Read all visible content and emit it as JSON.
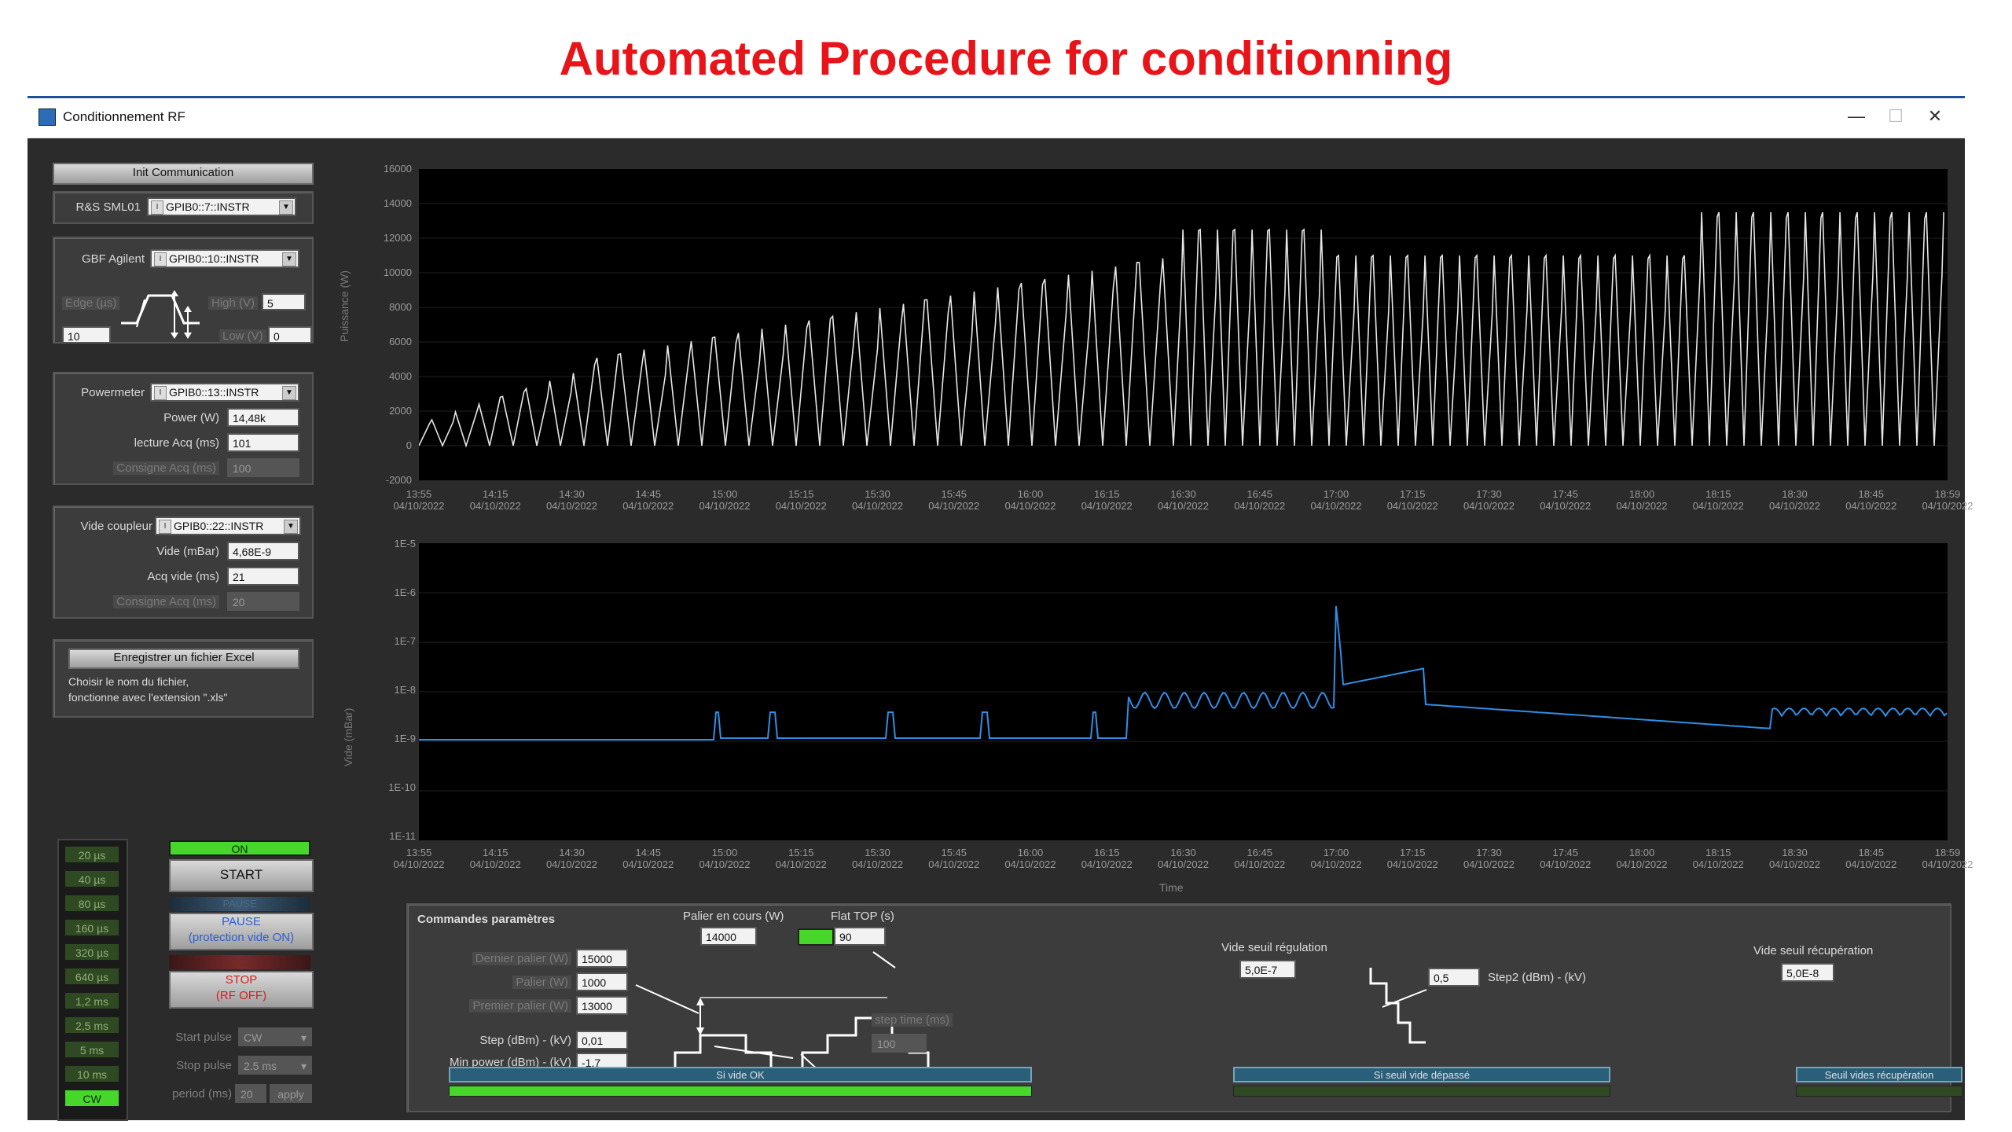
{
  "page_title": "Automated Procedure for conditionning",
  "window": {
    "title": "Conditionnement RF",
    "minimize": "—",
    "maximize": "☐",
    "close": "✕"
  },
  "left": {
    "init_button": "Init Communication",
    "sml": {
      "label": "R&S SML01",
      "value": "GPIB0::7::INSTR"
    },
    "gbf": {
      "label": "GBF Agilent",
      "value": "GPIB0::10::INSTR",
      "edge_label": "Edge (µs)",
      "edge_value": "10",
      "high_label": "High (V)",
      "high_value": "5",
      "low_label": "Low (V)",
      "low_value": "0"
    },
    "powermeter": {
      "label": "Powermeter",
      "value": "GPIB0::13::INSTR",
      "power_label": "Power (W)",
      "power_value": "14,48k",
      "lecture_label": "lecture Acq (ms)",
      "lecture_value": "101",
      "consigne_label": "Consigne Acq (ms)",
      "consigne_value": "100"
    },
    "vide": {
      "label": "Vide coupleur",
      "value": "GPIB0::22::INSTR",
      "vide_label": "Vide (mBar)",
      "vide_value": "4,68E-9",
      "acq_label": "Acq vide (ms)",
      "acq_value": "21",
      "consigne_label": "Consigne Acq (ms)",
      "consigne_value": "20"
    },
    "excel": {
      "button": "Enregistrer un fichier Excel",
      "note1": "Choisir le nom du fichier,",
      "note2": "fonctionne avec l'extension \".xls\""
    }
  },
  "leds": [
    {
      "label": "20 µs",
      "on": false
    },
    {
      "label": "40 µs",
      "on": false
    },
    {
      "label": "80 µs",
      "on": false
    },
    {
      "label": "160 µs",
      "on": false
    },
    {
      "label": "320 µs",
      "on": false
    },
    {
      "label": "640 µs",
      "on": false
    },
    {
      "label": "1,2 ms",
      "on": false
    },
    {
      "label": "2,5 ms",
      "on": false
    },
    {
      "label": "5 ms",
      "on": false
    },
    {
      "label": "10 ms",
      "on": false
    },
    {
      "label": "CW",
      "on": true
    }
  ],
  "controls": {
    "on_label": "ON",
    "start": "START",
    "pause_indicator": "PAUSE",
    "pause1": "PAUSE",
    "pause2": "(protection vide ON)",
    "stop_indicator": "STOP",
    "stop1": "STOP",
    "stop2": "(RF OFF)",
    "start_pulse_label": "Start pulse",
    "start_pulse_value": "CW",
    "stop_pulse_label": "Stop pulse",
    "stop_pulse_value": "2.5 ms",
    "period_label": "period (ms)",
    "period_value": "20",
    "apply": "apply"
  },
  "power_chart": {
    "ylabel": "Puissance (W)",
    "yticks": [
      "16000",
      "14000",
      "12000",
      "10000",
      "8000",
      "6000",
      "4000",
      "2000",
      "0",
      "-2000"
    ],
    "xtimes": [
      "13:55",
      "14:15",
      "14:30",
      "14:45",
      "15:00",
      "15:15",
      "15:30",
      "15:45",
      "16:00",
      "16:15",
      "16:30",
      "16:45",
      "17:00",
      "17:15",
      "17:30",
      "17:45",
      "18:00",
      "18:15",
      "18:30",
      "18:45",
      "18:59"
    ],
    "xdate": "04/10/2022"
  },
  "vacuum_chart": {
    "ylabel": "Vide (mBar)",
    "yticks": [
      "1E-5",
      "1E-6",
      "1E-7",
      "1E-8",
      "1E-9",
      "1E-10",
      "1E-11"
    ],
    "xtimes": [
      "13:55",
      "14:15",
      "14:30",
      "14:45",
      "15:00",
      "15:15",
      "15:30",
      "15:45",
      "16:00",
      "16:15",
      "16:30",
      "16:45",
      "17:00",
      "17:15",
      "17:30",
      "17:45",
      "18:00",
      "18:15",
      "18:30",
      "18:45",
      "18:59"
    ],
    "xdate": "04/10/2022",
    "xlabel": "Time"
  },
  "commands": {
    "title": "Commandes paramètres",
    "palier_cours_label": "Palier en cours (W)",
    "palier_cours_value": "14000",
    "flat_top_label": "Flat TOP (s)",
    "flat_top_value": "90",
    "dernier_label": "Dernier palier (W)",
    "dernier_value": "15000",
    "palier_label": "Palier (W)",
    "palier_value": "1000",
    "premier_label": "Premier palier (W)",
    "premier_value": "13000",
    "step_label": "Step (dBm) - (kV)",
    "step_value": "0,01",
    "minpower_label": "Min power (dBm) - (kV)",
    "minpower_value": "-1,7",
    "steptime_label": "step time (ms)",
    "steptime_value": "100",
    "seuil_reg_label": "Vide seuil régulation",
    "seuil_reg_value": "5,0E-7",
    "step2_label": "Step2 (dBm) - (kV)",
    "step2_value": "0,5",
    "seuil_recup_label": "Vide seuil récupération",
    "seuil_recup_value": "5,0E-8",
    "bar1": "Si vide OK",
    "bar2": "Si seuil vide dépassé",
    "bar3": "Seuil vides récupération"
  }
}
